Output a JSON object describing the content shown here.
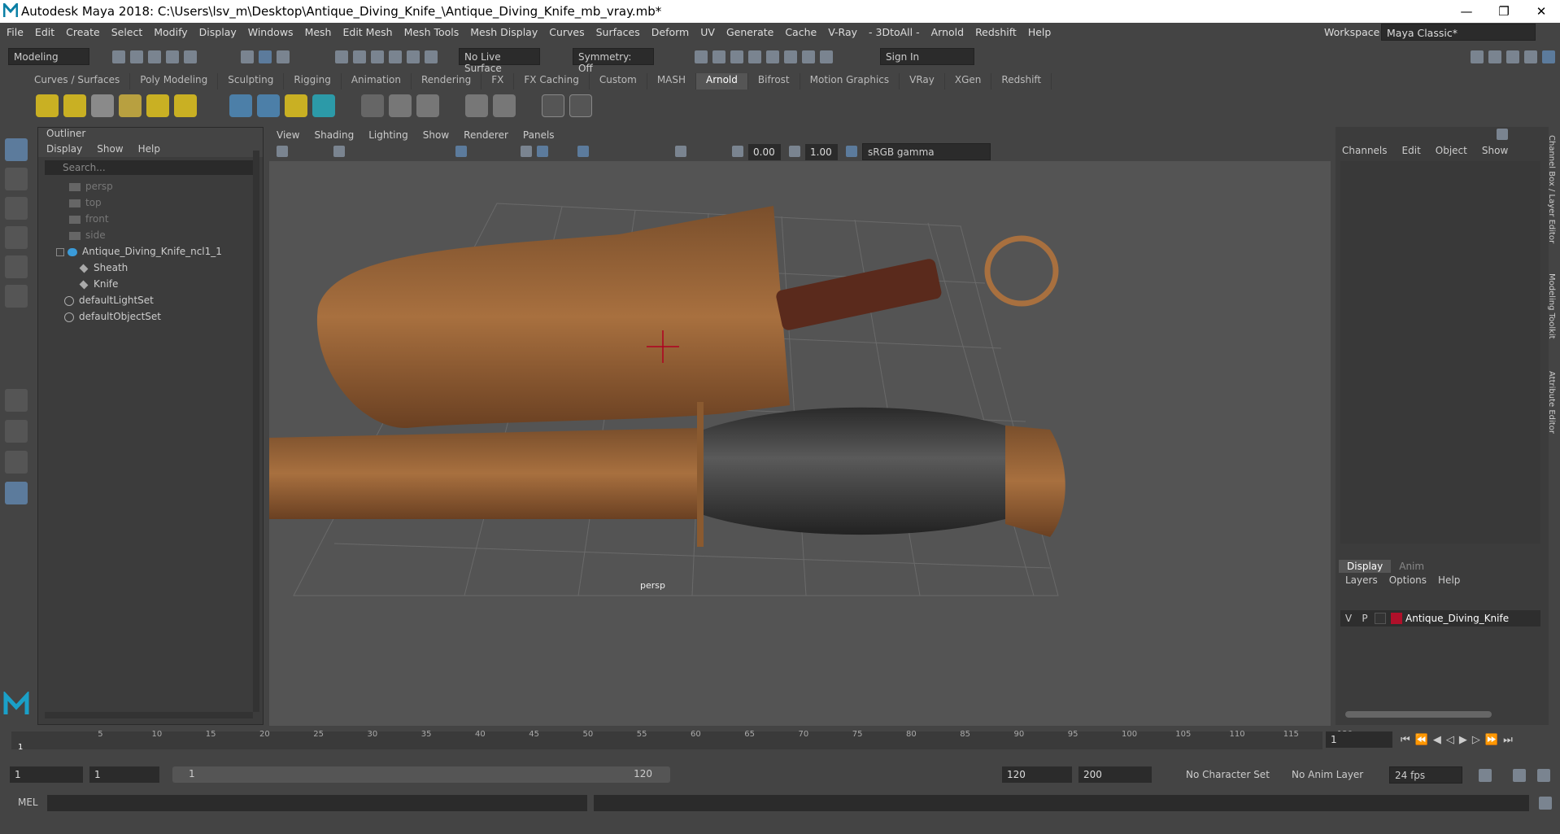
{
  "titlebar": {
    "title": "Autodesk Maya 2018: C:\\Users\\lsv_m\\Desktop\\Antique_Diving_Knife_\\Antique_Diving_Knife_mb_vray.mb*",
    "minimize": "—",
    "restore": "❐",
    "close": "✕"
  },
  "menubar": {
    "items": [
      "File",
      "Edit",
      "Create",
      "Select",
      "Modify",
      "Display",
      "Windows",
      "Mesh",
      "Edit Mesh",
      "Mesh Tools",
      "Mesh Display",
      "Curves",
      "Surfaces",
      "Deform",
      "UV",
      "Generate",
      "Cache",
      "V-Ray",
      "- 3DtoAll -",
      "Arnold",
      "Redshift",
      "Help"
    ]
  },
  "workspace": {
    "label": "Workspace :",
    "value": "Maya Classic*"
  },
  "status": {
    "mode": "Modeling",
    "live_surface": "No Live Surface",
    "symmetry": "Symmetry: Off",
    "sign_in": "Sign In"
  },
  "shelf_tabs": [
    "Curves / Surfaces",
    "Poly Modeling",
    "Sculpting",
    "Rigging",
    "Animation",
    "Rendering",
    "FX",
    "FX Caching",
    "Custom",
    "MASH",
    "Arnold",
    "Bifrost",
    "Motion Graphics",
    "VRay",
    "XGen",
    "Redshift"
  ],
  "shelf_active": "Arnold",
  "outliner": {
    "title": "Outliner",
    "menus": [
      "Display",
      "Show",
      "Help"
    ],
    "search_placeholder": "Search...",
    "items": {
      "persp": "persp",
      "top": "top",
      "front": "front",
      "side": "side",
      "group": "Antique_Diving_Knife_ncl1_1",
      "sheath": "Sheath",
      "knife": "Knife",
      "light_set": "defaultLightSet",
      "object_set": "defaultObjectSet"
    }
  },
  "viewport": {
    "menus": [
      "View",
      "Shading",
      "Lighting",
      "Show",
      "Renderer",
      "Panels"
    ],
    "exposure": "0.00",
    "gamma": "1.00",
    "color_space": "sRGB gamma",
    "camera_label": "persp"
  },
  "channel_box": {
    "menus": [
      "Channels",
      "Edit",
      "Object",
      "Show"
    ]
  },
  "layer_editor": {
    "tabs": [
      "Display",
      "Anim"
    ],
    "menus": [
      "Layers",
      "Options",
      "Help"
    ],
    "layer": {
      "v": "V",
      "p": "P",
      "name": "Antique_Diving_Knife",
      "color": "#b0102a"
    }
  },
  "side_tabs": [
    "Channel Box / Layer Editor",
    "Modeling Toolkit",
    "Attribute Editor"
  ],
  "timeline": {
    "ticks": [
      "5",
      "10",
      "15",
      "20",
      "25",
      "30",
      "35",
      "40",
      "45",
      "50",
      "55",
      "60",
      "65",
      "70",
      "75",
      "80",
      "85",
      "90",
      "95",
      "100",
      "105",
      "110",
      "115",
      "120"
    ],
    "current": "1",
    "current_frame_field": "1"
  },
  "range": {
    "start": "1",
    "start2": "1",
    "slider_start": "1",
    "slider_end": "120",
    "end": "120",
    "end2": "200",
    "character_set": "No Character Set",
    "anim_layer": "No Anim Layer",
    "fps": "24 fps"
  },
  "cmdline": {
    "label": "MEL"
  },
  "colors": {
    "accent": "#5c7b9c",
    "bronze": "#a8703f",
    "grip": "#3a3a3a"
  }
}
